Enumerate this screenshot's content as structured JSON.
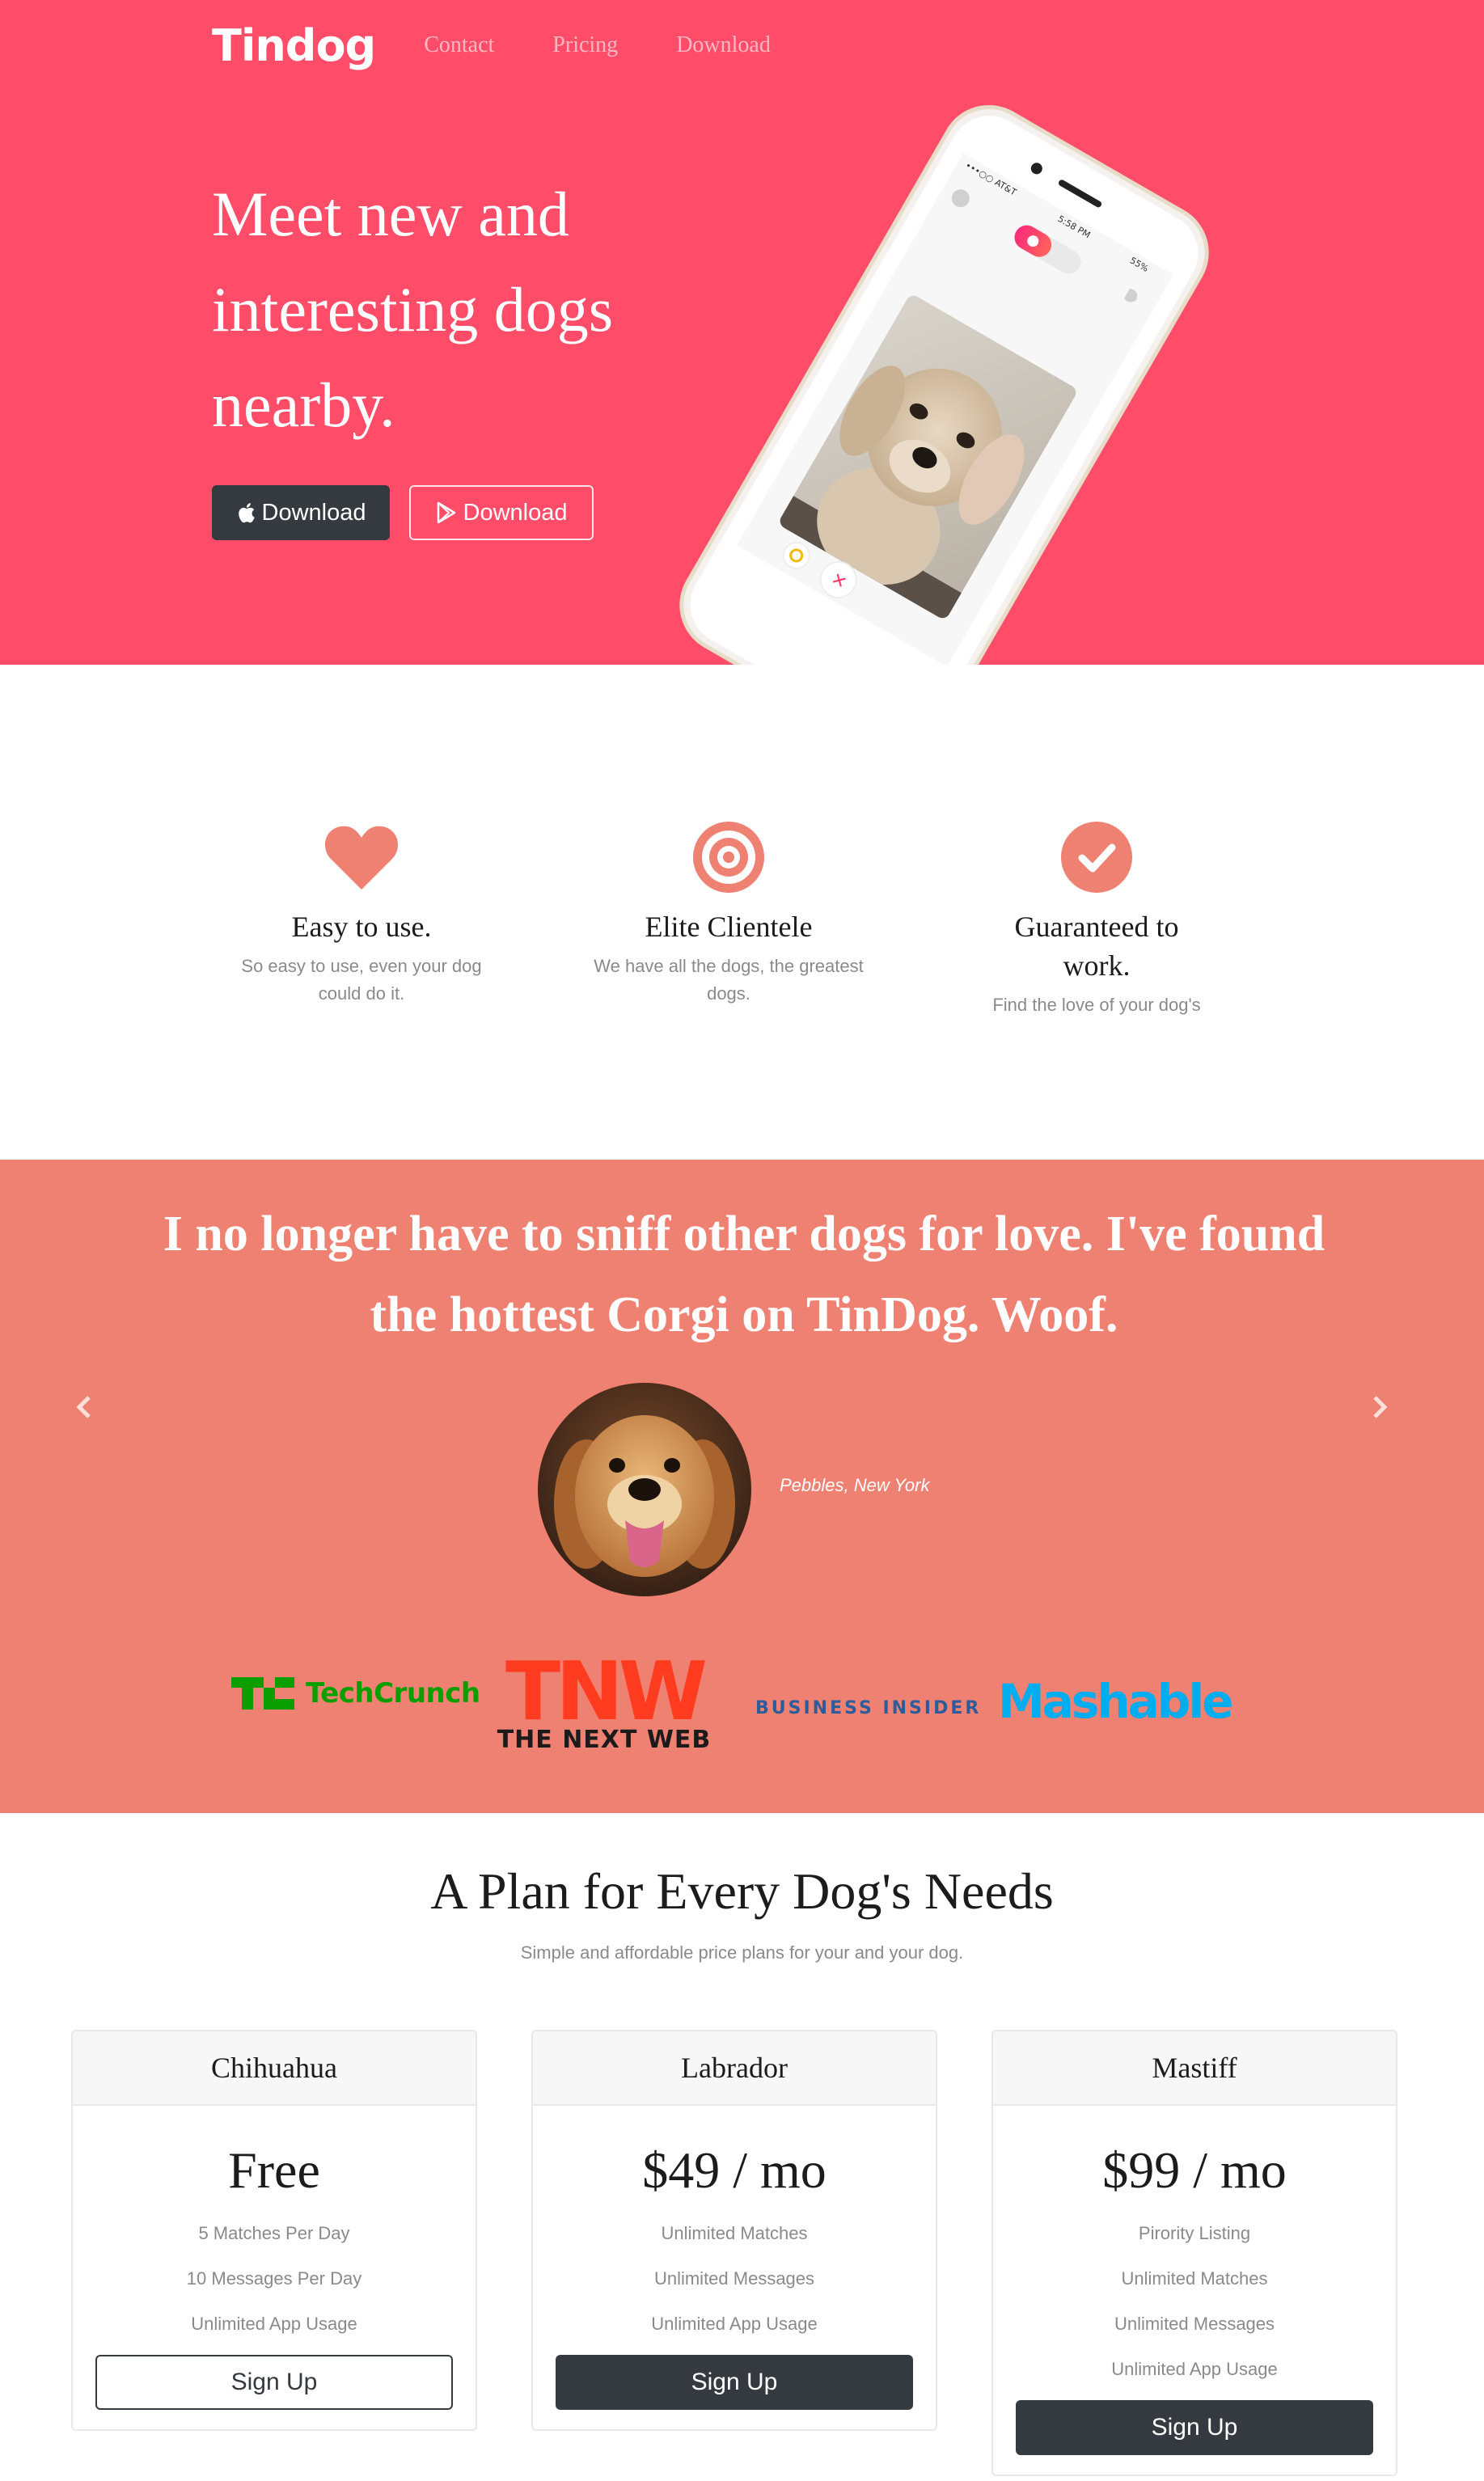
{
  "nav": {
    "brand": "Tindog",
    "links": [
      "Contact",
      "Pricing",
      "Download"
    ]
  },
  "hero": {
    "title": "Meet new and interesting dogs nearby.",
    "download_apple": "Download",
    "download_play": "Download",
    "phone": {
      "carrier": "•••○○ AT&T",
      "time": "5:58 PM",
      "battery": "55%"
    }
  },
  "features": [
    {
      "icon": "heart-icon",
      "title": "Easy to use.",
      "text": "So easy to use, even your dog could do it."
    },
    {
      "icon": "bullseye-icon",
      "title": "Elite Clientele",
      "text": "We have all the dogs, the greatest dogs."
    },
    {
      "icon": "check-circle-icon",
      "title": "Guaranteed to work.",
      "text": "Find the love of your dog's"
    }
  ],
  "testimonial": {
    "quote": "I no longer have to sniff other dogs for love. I've found the hottest Corgi on TinDog. Woof.",
    "author": "Pebbles, New York"
  },
  "press": {
    "techcrunch": "TechCrunch",
    "tnw_big": "TNW",
    "tnw_small": "THE NEXT WEB",
    "business_insider": "BUSINESS INSIDER",
    "mashable": "Mashable"
  },
  "pricing": {
    "title": "A Plan for Every Dog's Needs",
    "subtitle": "Simple and affordable price plans for your and your dog.",
    "plans": [
      {
        "name": "Chihuahua",
        "price": "Free",
        "features": [
          "5 Matches Per Day",
          "10 Messages Per Day",
          "Unlimited App Usage"
        ],
        "cta": "Sign Up",
        "style": "outline"
      },
      {
        "name": "Labrador",
        "price": "$49 / mo",
        "features": [
          "Unlimited Matches",
          "Unlimited Messages",
          "Unlimited App Usage"
        ],
        "cta": "Sign Up",
        "style": "solid"
      },
      {
        "name": "Mastiff",
        "price": "$99 / mo",
        "features": [
          "Pirority Listing",
          "Unlimited Matches",
          "Unlimited Messages",
          "Unlimited App Usage"
        ],
        "cta": "Sign Up",
        "style": "solid"
      }
    ]
  },
  "colors": {
    "hero_bg": "#ff4c68",
    "accent": "#ef8172",
    "dark_button": "#343a40"
  }
}
